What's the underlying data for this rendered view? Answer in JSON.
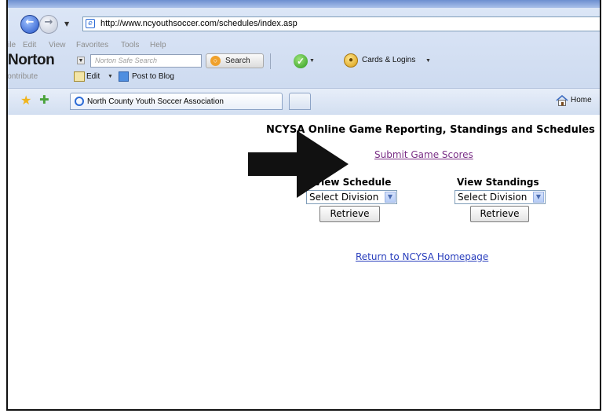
{
  "browser": {
    "address_url": "http://www.ncyouthsoccer.com/schedules/index.asp",
    "menu": [
      "File",
      "Edit",
      "View",
      "Favorites",
      "Tools",
      "Help"
    ],
    "norton": {
      "logo": "Norton",
      "search_placeholder": "Norton Safe Search",
      "search_button": "Search",
      "cards_logins": "Cards & Logins"
    },
    "blog_toolbar": {
      "contribute": "Contribute",
      "edit": "Edit",
      "post_to_blog": "Post to Blog"
    },
    "tab_title": "North County Youth Soccer Association",
    "home_label": "Home",
    "icons": [
      "back-icon",
      "forward-icon",
      "ie-page-icon",
      "search-icon",
      "check-icon",
      "cards-lock-icon",
      "edit-icon",
      "post-blog-icon",
      "favorites-star-icon",
      "add-favorites-icon",
      "home-icon"
    ]
  },
  "page": {
    "title": "NCYSA Online Game Reporting, Standings and Schedules",
    "submit_link": "Submit Game Scores",
    "schedule_heading": "View Schedule",
    "standings_heading": "View Standings",
    "schedule_select_value": "Select Division",
    "standings_select_value": "Select Division",
    "schedule_button": "Retrieve",
    "standings_button": "Retrieve",
    "home_link": "Return to NCYSA Homepage"
  },
  "colors": {
    "visited_link": "#7a2f86",
    "link": "#2a3fbd",
    "annotation_arrow": "#111111"
  }
}
